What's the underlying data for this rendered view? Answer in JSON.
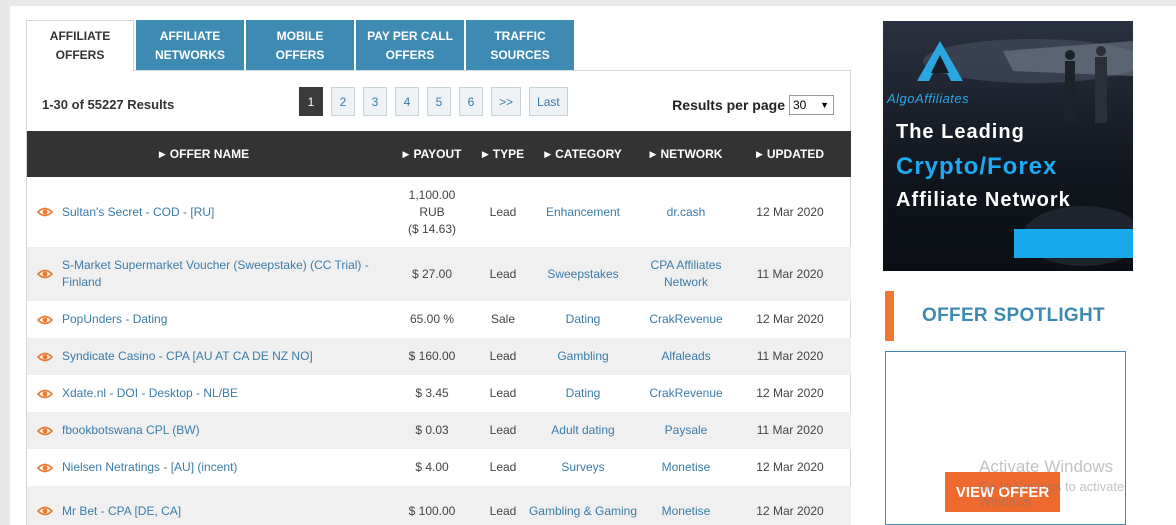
{
  "tabs": [
    {
      "label": "AFFILIATE\nOFFERS",
      "active": true
    },
    {
      "label": "AFFILIATE\nNETWORKS",
      "active": false
    },
    {
      "label": "MOBILE\nOFFERS",
      "active": false
    },
    {
      "label": "PAY PER CALL\nOFFERS",
      "active": false
    },
    {
      "label": "TRAFFIC\nSOURCES",
      "active": false
    }
  ],
  "results_summary": "1-30 of 55227 Results",
  "pagination": [
    "1",
    "2",
    "3",
    "4",
    "5",
    "6",
    ">>",
    "Last"
  ],
  "results_per_page": {
    "label": "Results per page",
    "value": "30"
  },
  "table": {
    "headers": [
      "OFFER NAME",
      "PAYOUT",
      "TYPE",
      "CATEGORY",
      "NETWORK",
      "UPDATED"
    ],
    "rows": [
      {
        "name": "Sultan's Secret - COD - [RU]",
        "payout": "1,100.00\nRUB\n($ 14.63)",
        "type": "Lead",
        "category": "Enhancement",
        "network": "dr.cash",
        "updated": "12 Mar 2020"
      },
      {
        "name": "S-Market Supermarket Voucher (Sweepstake) (CC Trial) - Finland",
        "payout": "$  27.00",
        "type": "Lead",
        "category": "Sweepstakes",
        "network": "CPA Affiliates Network",
        "updated": "11 Mar 2020"
      },
      {
        "name": "PopUnders - Dating",
        "payout": "65.00 %",
        "type": "Sale",
        "category": "Dating",
        "network": "CrakRevenue",
        "updated": "12 Mar 2020"
      },
      {
        "name": "Syndicate Casino - CPA [AU AT CA DE NZ NO]",
        "payout": "$  160.00",
        "type": "Lead",
        "category": "Gambling",
        "network": "Alfaleads",
        "updated": "11 Mar 2020"
      },
      {
        "name": "Xdate.nl - DOI - Desktop - NL/BE",
        "payout": "$  3.45",
        "type": "Lead",
        "category": "Dating",
        "network": "CrakRevenue",
        "updated": "12 Mar 2020"
      },
      {
        "name": "fbookbotswana CPL (BW)",
        "payout": "$  0.03",
        "type": "Lead",
        "category": "Adult dating",
        "network": "Paysale",
        "updated": "11 Mar 2020"
      },
      {
        "name": "Nielsen Netratings - [AU] (incent)",
        "payout": "$  4.00",
        "type": "Lead",
        "category": "Surveys",
        "network": "Monetise",
        "updated": "12 Mar 2020"
      },
      {
        "name": "Mr Bet - CPA [DE, CA]",
        "payout": "$  100.00",
        "type": "Lead",
        "category": "Gambling & Gaming",
        "network": "Monetise",
        "updated": "12 Mar 2020"
      }
    ]
  },
  "ad": {
    "logo": "AlgoAffiliates",
    "line1": "The Leading",
    "line2": "Crypto/Forex",
    "line3": "Affiliate Network"
  },
  "spotlight": {
    "title": "OFFER SPOTLIGHT",
    "button": "VIEW OFFER"
  },
  "watermark": {
    "line1": "Activate Windows",
    "line2": "Go to Settings to activate Windows."
  },
  "colors": {
    "accent_blue": "#3d8ab3",
    "accent_orange": "#ee6a2f",
    "header_dark": "#333333"
  }
}
